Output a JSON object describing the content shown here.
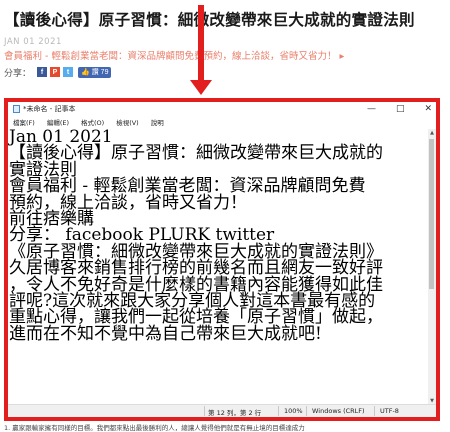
{
  "article": {
    "title": "【讀後心得】原子習慣：細微改變帶來巨大成就的實證法則",
    "date": "JAN 01 2021",
    "promo": "會員福利 - 輕鬆創業當老闆：資深品牌顧問免費預約，線上洽談，省時又省力！ ▸",
    "share_label": "分享：",
    "share_icons": [
      "facebook-icon",
      "plurk-icon",
      "twitter-icon"
    ],
    "like_label": "讚 79",
    "accent_color": "#e21e1e",
    "bottom_text": "1. 贏家跟輸家擁有同樣的目標。我們都來點出最後勝利的人，總讓人覺得他們就是有無止境的目標達成力"
  },
  "notepad": {
    "window_title": "*未命名 - 記事本",
    "controls": [
      "—",
      "□",
      "✕"
    ],
    "menu": [
      "檔案(F)",
      "編輯(E)",
      "格式(O)",
      "檢視(V)",
      "說明"
    ],
    "lines": [
      "Jan 01 2021",
      "【讀後心得】原子習慣：細微改變帶來巨大成就的",
      "實證法則",
      "會員福利 - 輕鬆創業當老闆：資深品牌顧問免費",
      "預約，線上洽談，省時又省力！",
      "前往痞樂購",
      "分享： facebook PLURK twitter",
      "《原子習慣：細微改變帶來巨大成就的實證法則》",
      "久居博客來銷售排行榜的前幾名而且網友一致好評",
      "，令人不免好奇是什麼樣的書籍內容能獲得如此佳",
      "評呢?這次就來跟大家分享個人對這本書最有感的",
      "重點心得，讓我們一起從培養「原子習慣」做起，",
      "進而在不知不覺中為自己帶來巨大成就吧!"
    ],
    "status": {
      "position": "第 12 列，第 2 行",
      "zoom": "100%",
      "line_ending": "Windows (CRLF)",
      "encoding": "UTF-8"
    }
  }
}
